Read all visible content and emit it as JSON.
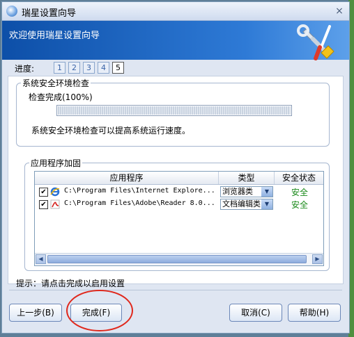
{
  "window": {
    "title": "瑞星设置向导",
    "close_glyph": "×"
  },
  "header": {
    "welcome": "欢迎使用瑞星设置向导",
    "icon": "tools-icon"
  },
  "progress": {
    "label": "进度:",
    "steps": [
      "1",
      "2",
      "3",
      "4",
      "5"
    ],
    "current_step": 5
  },
  "security_check": {
    "group_title": "系统安全环境检查",
    "status": "检查完成(100%)",
    "progress_fraction": 1.0,
    "description": "系统安全环境检查可以提高系统运行速度。"
  },
  "hardening": {
    "group_title": "应用程序加固",
    "columns": [
      "应用程序",
      "类型",
      "安全状态"
    ],
    "rows": [
      {
        "checked": true,
        "icon": "internet-explorer-icon",
        "path": "C:\\Program Files\\Internet Explore...",
        "type": "浏览器类",
        "status": "安全"
      },
      {
        "checked": true,
        "icon": "adobe-reader-icon",
        "path": "C:\\Program Files\\Adobe\\Reader 8.0...",
        "type": "文档编辑类",
        "status": "安全"
      }
    ]
  },
  "tip": "提示：请点击完成以启用设置",
  "buttons": {
    "back": "上一步(B)",
    "finish": "完成(F)",
    "cancel": "取消(C)",
    "help": "帮助(H)"
  },
  "colors": {
    "header": "#1d63c4",
    "status_safe": "#1a8a1a",
    "highlight": "#e0281c"
  }
}
